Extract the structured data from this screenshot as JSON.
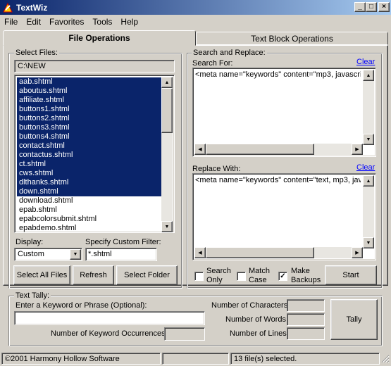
{
  "window": {
    "title": "TextWiz",
    "min": "_",
    "max": "□",
    "close": "×"
  },
  "menu": [
    "File",
    "Edit",
    "Favorites",
    "Tools",
    "Help"
  ],
  "tabs": {
    "file_ops": "File Operations",
    "text_block": "Text Block Operations"
  },
  "select_files": {
    "label": "Select Files:",
    "path": "C:\\NEW",
    "files": [
      {
        "name": "aab.shtml",
        "selected": true
      },
      {
        "name": "aboutus.shtml",
        "selected": true
      },
      {
        "name": "affiliate.shtml",
        "selected": true
      },
      {
        "name": "buttons1.shtml",
        "selected": true
      },
      {
        "name": "buttons2.shtml",
        "selected": true
      },
      {
        "name": "buttons3.shtml",
        "selected": true
      },
      {
        "name": "buttons4.shtml",
        "selected": true
      },
      {
        "name": "contact.shtml",
        "selected": true
      },
      {
        "name": "contactus.shtml",
        "selected": true
      },
      {
        "name": "ct.shtml",
        "selected": true
      },
      {
        "name": "cws.shtml",
        "selected": true
      },
      {
        "name": "dlthanks.shtml",
        "selected": true
      },
      {
        "name": "down.shtml",
        "selected": true
      },
      {
        "name": "download.shtml",
        "selected": false
      },
      {
        "name": "epab.shtml",
        "selected": false
      },
      {
        "name": "epabcolorsubmit.shtml",
        "selected": false
      },
      {
        "name": "epabdemo.shtml",
        "selected": false
      }
    ],
    "display_label": "Display:",
    "display_value": "Custom",
    "filter_label": "Specify Custom Filter:",
    "filter_value": "*.shtml",
    "select_all": "Select All Files",
    "refresh": "Refresh",
    "select_folder": "Select Folder"
  },
  "search_replace": {
    "label": "Search and Replace:",
    "search_for": "Search For:",
    "clear": "Clear",
    "search_text": "<meta name=\"keywords\" content=\"mp3, javascrip",
    "replace_with": "Replace With:",
    "replace_text": "<meta name=\"keywords\" content=\"text, mp3, java",
    "search_only": "Search Only",
    "match_case": "Match Case",
    "make_backups": "Make Backups",
    "search_only_checked": false,
    "match_case_checked": false,
    "make_backups_checked": true,
    "start": "Start"
  },
  "tally": {
    "label": "Text Tally:",
    "keyword_label": "Enter a Keyword or Phrase (Optional):",
    "occurrences_label": "Number of Keyword Occurrences:",
    "characters_label": "Number of Characters:",
    "words_label": "Number of Words:",
    "lines_label": "Number of Lines:",
    "tally_button": "Tally"
  },
  "status": {
    "copyright": "©2001 Harmony Hollow Software",
    "selected": "13 file(s) selected."
  },
  "colors": {
    "title_start": "#0a246a",
    "title_end": "#a6caf0",
    "selection": "#0a246a",
    "face": "#d4d0c8",
    "link": "#0000ff"
  }
}
